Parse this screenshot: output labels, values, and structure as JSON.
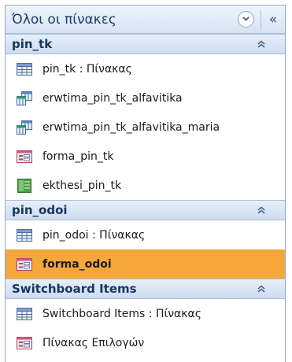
{
  "pane": {
    "title": "Όλοι οι πίνακες",
    "collapse_glyph": "«"
  },
  "groups": [
    {
      "title": "pin_tk",
      "items": [
        {
          "label": "pin_tk : Πίνακας",
          "icon": "table-icon"
        },
        {
          "label": "erwtima_pin_tk_alfavitika",
          "icon": "query-icon"
        },
        {
          "label": "erwtima_pin_tk_alfavitika_maria",
          "icon": "query-icon"
        },
        {
          "label": "forma_pin_tk",
          "icon": "form-icon"
        },
        {
          "label": "ekthesi_pin_tk",
          "icon": "report-icon"
        }
      ]
    },
    {
      "title": "pin_odoi",
      "items": [
        {
          "label": "pin_odoi : Πίνακας",
          "icon": "table-icon"
        },
        {
          "label": "forma_odoi",
          "icon": "form-icon",
          "selected": true
        }
      ]
    },
    {
      "title": "Switchboard Items",
      "items": [
        {
          "label": "Switchboard Items : Πίνακας",
          "icon": "table-icon"
        },
        {
          "label": "Πίνακας Επιλογών",
          "icon": "form-icon"
        }
      ]
    }
  ],
  "colors": {
    "selection": "#f5a73a",
    "header_text": "#17355e",
    "border": "#8fa9cf"
  }
}
